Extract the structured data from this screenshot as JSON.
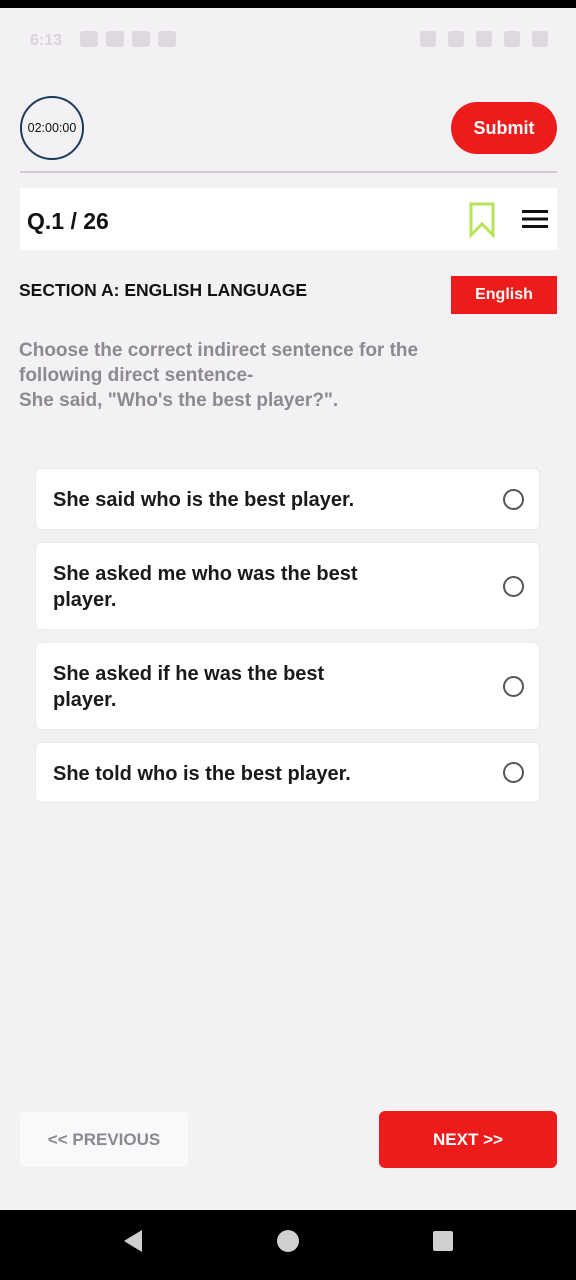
{
  "status_bar": {
    "time": "6:13",
    "left_icons": [
      "linkedin-icon",
      "youtube-icon",
      "chart-icon",
      "gallery-icon"
    ],
    "right_icons": [
      "alarm-icon",
      "bluetooth-icon",
      "data-icon",
      "signal-icon",
      "battery-icon"
    ]
  },
  "header": {
    "timer": "02:00:00",
    "submit_label": "Submit"
  },
  "question_bar": {
    "number": "Q.1 / 26",
    "bookmark_icon": "bookmark-icon",
    "menu_icon": "hamburger-menu-icon"
  },
  "section": {
    "title": "SECTION A: ENGLISH LANGUAGE",
    "language": "English"
  },
  "question": {
    "lines": [
      "Choose the correct indirect sentence for the",
      "following direct sentence-",
      "She said, \"Who's the best player?\"."
    ]
  },
  "options": [
    {
      "lines": [
        "She said who is the best player."
      ]
    },
    {
      "lines": [
        "She asked me who was the best",
        "player."
      ]
    },
    {
      "lines": [
        "She asked if he was the best",
        "player."
      ]
    },
    {
      "lines": [
        "She told who is the best player."
      ]
    }
  ],
  "footer": {
    "previous_label": "<< PREVIOUS",
    "next_label": "NEXT >>"
  },
  "colors": {
    "accent_red": "#ee1b1b",
    "bookmark": "#b6e35a",
    "question_text": "#8c8a8e",
    "background": "#f4f1f5"
  }
}
